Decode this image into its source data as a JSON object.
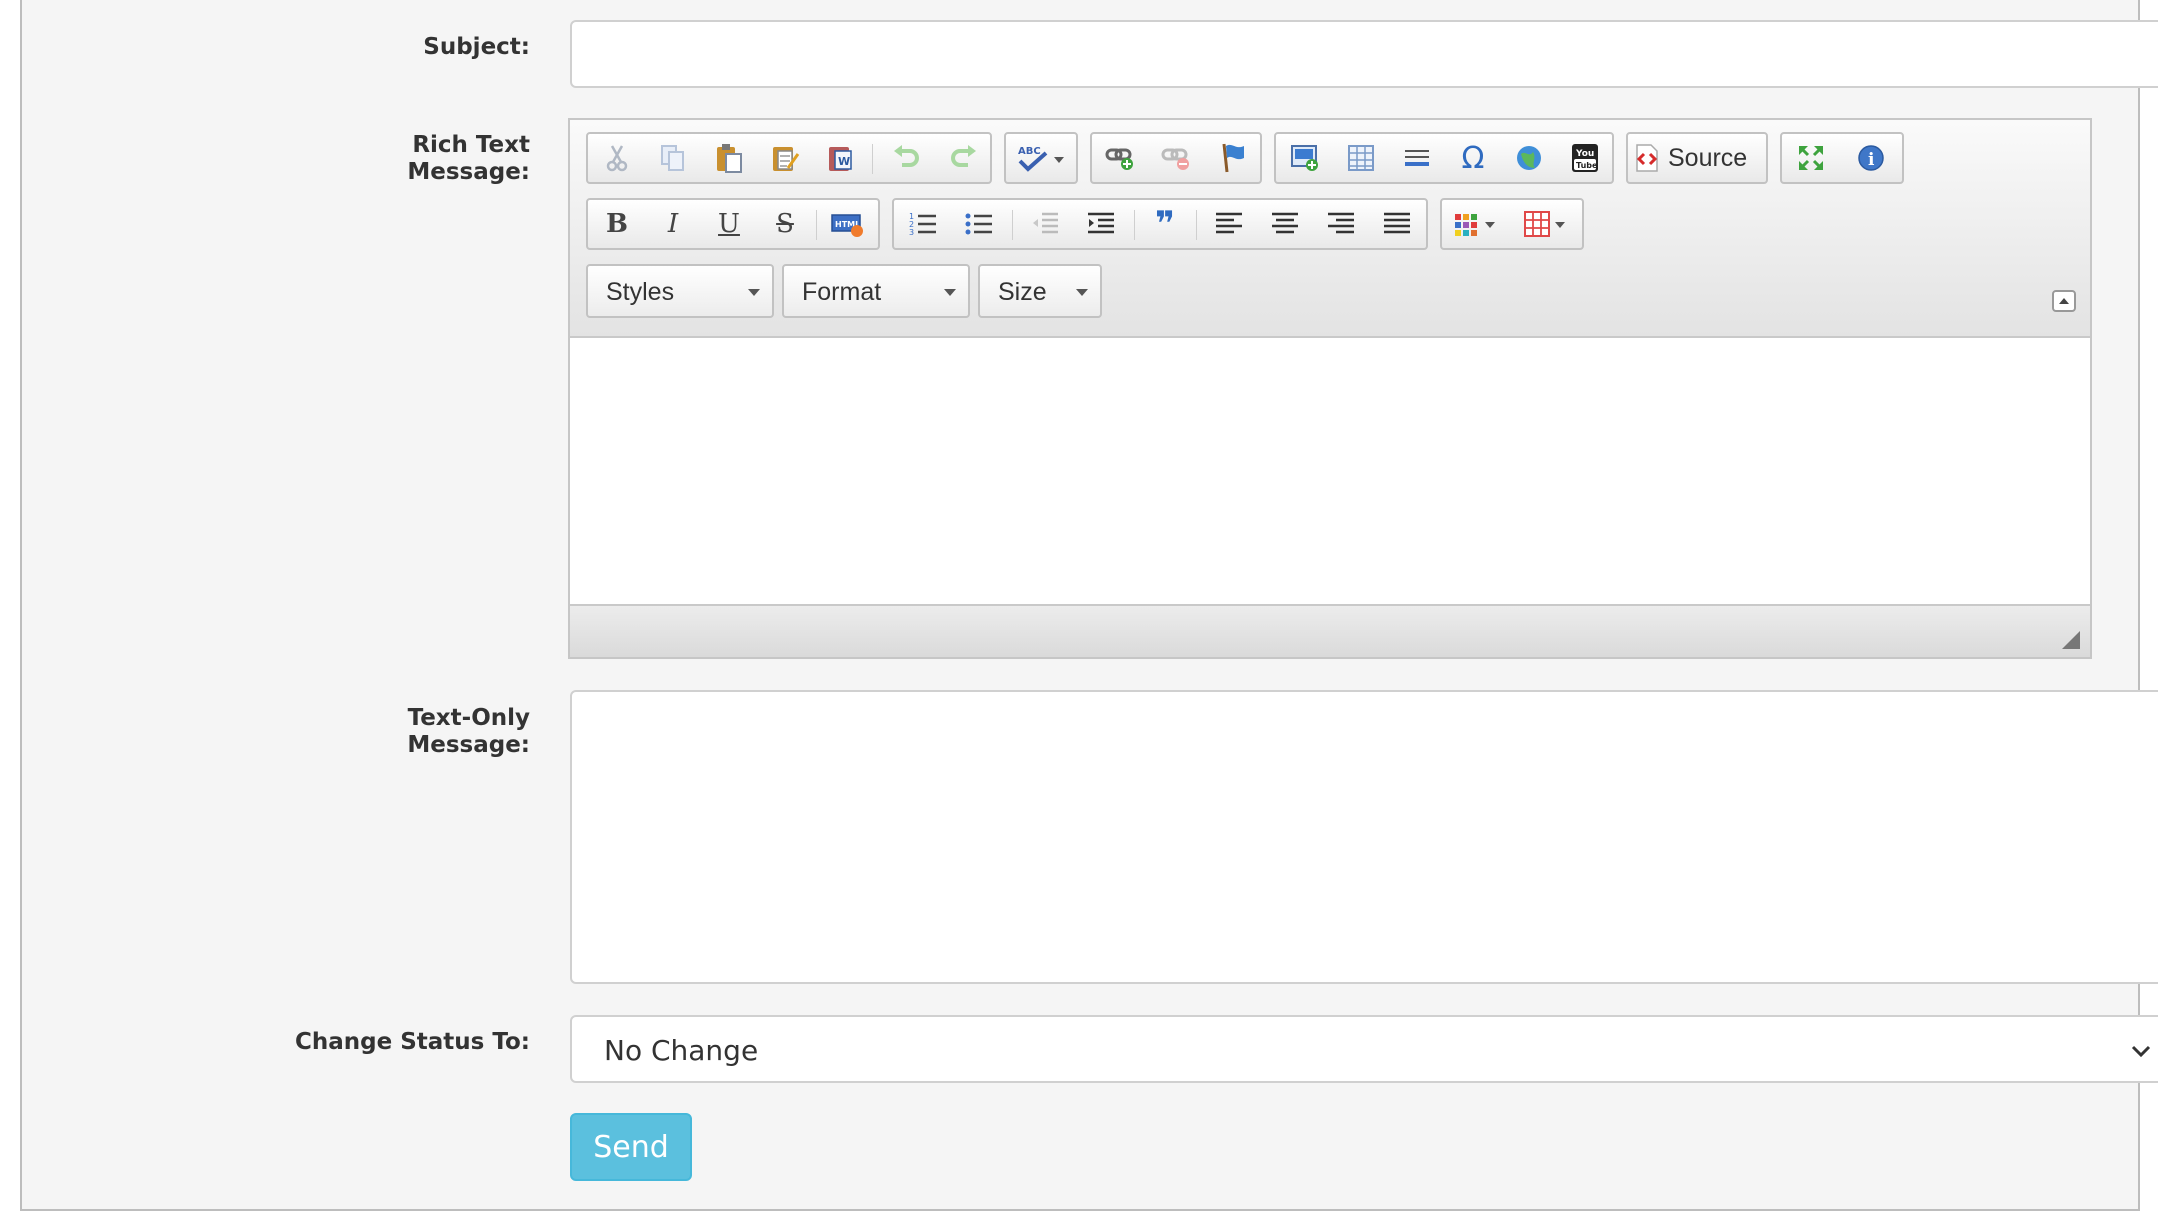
{
  "form": {
    "subject_label": "Subject:",
    "subject_value": "",
    "rich_label": "Rich Text\nMessage:",
    "text_only_label": "Text-Only\nMessage:",
    "text_only_value": "",
    "status_label": "Change Status To:",
    "status_value": "No Change",
    "send_label": "Send"
  },
  "editor": {
    "source_label": "Source",
    "styles_label": "Styles",
    "format_label": "Format",
    "size_label": "Size",
    "toolbar_icons": {
      "row1": [
        "cut-icon",
        "copy-icon",
        "paste-icon",
        "paste-text-icon",
        "paste-word-icon",
        "undo-icon",
        "redo-icon",
        "spellcheck-icon",
        "link-icon",
        "unlink-icon",
        "anchor-icon",
        "image-icon",
        "table-icon",
        "horizontal-rule-icon",
        "special-char-icon",
        "iframe-icon",
        "youtube-icon",
        "source-icon",
        "maximize-icon",
        "about-icon"
      ],
      "row2": [
        "bold-icon",
        "italic-icon",
        "underline-icon",
        "strikethrough-icon",
        "html-snippet-icon",
        "numbered-list-icon",
        "bulleted-list-icon",
        "outdent-icon",
        "indent-icon",
        "blockquote-icon",
        "align-left-icon",
        "align-center-icon",
        "align-right-icon",
        "justify-icon",
        "text-color-icon",
        "table-grid-icon"
      ]
    },
    "glyphs": {
      "bold": "B",
      "italic": "I",
      "underline": "U",
      "strike": "S",
      "omega": "Ω",
      "quote": "❞",
      "info": "i"
    }
  },
  "colors": {
    "accent": "#5bc0de",
    "panel": "#f5f5f5",
    "border": "#bdbdbd"
  }
}
